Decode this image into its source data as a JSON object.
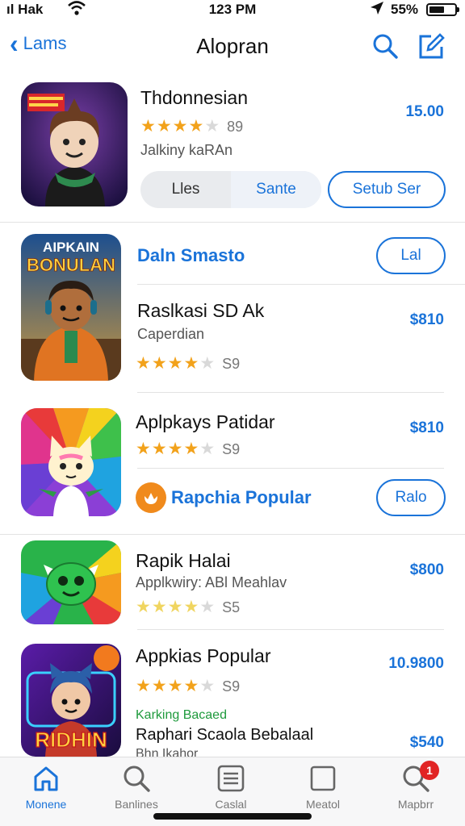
{
  "status_bar": {
    "carrier": "ıl Hak",
    "time": "123 PM",
    "battery_pct": "55%",
    "icons": [
      "wifi-icon",
      "location-icon",
      "battery-icon"
    ]
  },
  "nav": {
    "back_label": "Lams",
    "title": "Alopran",
    "icons": [
      "search-icon",
      "compose-icon"
    ]
  },
  "featured": {
    "name": "Thdonnesian",
    "rating_count": "89",
    "subtitle": "Jalkiny kaRAn",
    "price": "15.00",
    "segments": [
      "Lles",
      "Sante"
    ],
    "action_button": "Setub Ser"
  },
  "section_one": {
    "title": "Daln Smasto",
    "button": "Lal"
  },
  "apps": [
    {
      "name": "Raslkasi SD Ak",
      "subtitle": "Caperdian",
      "rating_count": "S9",
      "price": "$810",
      "icon_text_top": "AIPKAIN",
      "icon_text_main": "BONULAN"
    },
    {
      "name": "Aplpkays Patidar",
      "rating_count": "S9",
      "price": "$810"
    },
    {
      "name": "Rapik Halai",
      "subtitle": "Applkwiry: ABl Meahlav",
      "rating_count": "S5",
      "price": "$800"
    },
    {
      "name": "Appkias Popular",
      "rating_count": "S9",
      "price": "10.9800",
      "green_label": "Karking Bacaed",
      "name2": "Raphari Scaola Bebalaal",
      "subtitle2": "Bhn Ikahor",
      "price2": "$540",
      "icon_text_main": "RIDHIN"
    }
  ],
  "section_two": {
    "title": "Rapchia Popular",
    "button": "Ralo"
  },
  "tabbar": {
    "tabs": [
      {
        "label": "Monene",
        "icon": "home-icon"
      },
      {
        "label": "Banlines",
        "icon": "search-icon"
      },
      {
        "label": "Caslal",
        "icon": "list-icon"
      },
      {
        "label": "Meatol",
        "icon": "square-icon"
      },
      {
        "label": "Mapbrr",
        "icon": "search-icon"
      }
    ],
    "badge_count": "1"
  },
  "colors": {
    "accent": "#1a73d9",
    "star": "#f2a21b",
    "green": "#1e9a3c",
    "badge": "#e12424"
  }
}
